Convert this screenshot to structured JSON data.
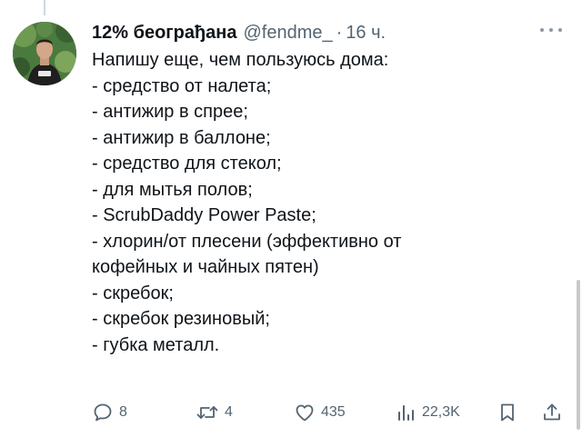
{
  "tweet": {
    "display_name": "12% београђана",
    "handle": "@fendme_",
    "separator": "·",
    "timestamp": "16 ч.",
    "lines": [
      "Напишу еще, чем пользуюсь дома:",
      "- средство от налета;",
      "- антижир в спрее;",
      "- антижир в баллоне;",
      "- средство для стекол;",
      "- для мытья полов;",
      "- ScrubDaddy Power Paste;",
      "- хлорин/от плесени (эффективно от",
      "кофейных и чайных пятен)",
      "- скребок;",
      "- скребок резиновый;",
      "- губка металл."
    ]
  },
  "actions": {
    "reply_count": "8",
    "retweet_count": "4",
    "like_count": "435",
    "views_count": "22,3K"
  },
  "icons": {
    "more": "more-horizontal-icon",
    "reply": "reply-icon",
    "retweet": "retweet-icon",
    "like": "heart-icon",
    "views": "views-chart-icon",
    "bookmark": "bookmark-icon",
    "share": "share-icon"
  },
  "colors": {
    "text": "#0f1419",
    "secondary": "#536471"
  }
}
